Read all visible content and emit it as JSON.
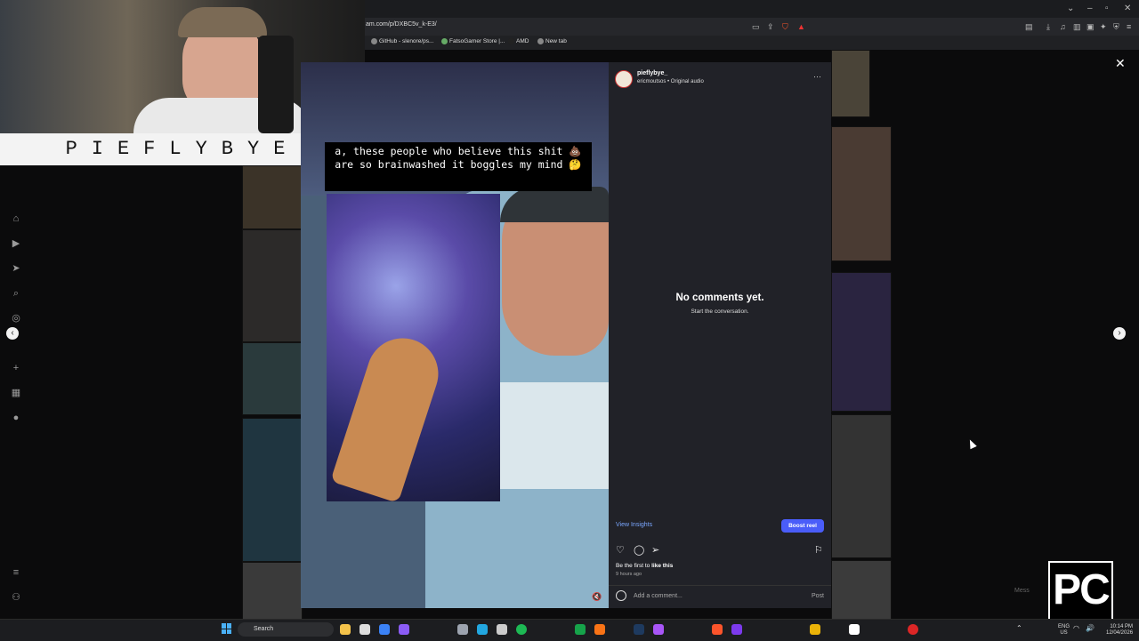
{
  "browser": {
    "url": "am.com/p/DXBC5v_k-E3/",
    "bookmarks": [
      "GitHub - slenore/ps...",
      "FatsoGamer Store |...",
      "AMD",
      "New tab"
    ],
    "window_controls": [
      "⌄",
      "–",
      "▫",
      "✕"
    ]
  },
  "webcam": {
    "name_banner": "PIEFLYBYE"
  },
  "reel": {
    "caption": "a, these people who believe this shit 💩 are so brainwashed it boggles my mind 🤔"
  },
  "post_panel": {
    "username": "pieflybye_",
    "audio_line": "ericmoutsos • Original audio",
    "more_label": "···",
    "empty_title": "No comments yet.",
    "empty_sub": "Start the conversation.",
    "view_insights": "View Insights",
    "boost_label": "Boost reel",
    "likes_prefix": "Be the first to ",
    "likes_strong": "like this",
    "time_ago": "9 hours ago",
    "comment_placeholder": "Add a comment...",
    "post_label": "Post"
  },
  "overlay": {
    "close_label": "✕",
    "prev_label": "‹",
    "next_label": "›",
    "messages_label": "Mess"
  },
  "logo": {
    "text": "PC"
  },
  "taskbar": {
    "search_label": "Search",
    "lang_top": "ENG",
    "lang_bottom": "US",
    "time": "10:14 PM",
    "date": "12/04/2026"
  },
  "colors": {
    "accent_button": "#4a5df9",
    "link": "#7aa7ff",
    "panel_bg": "#212228"
  }
}
